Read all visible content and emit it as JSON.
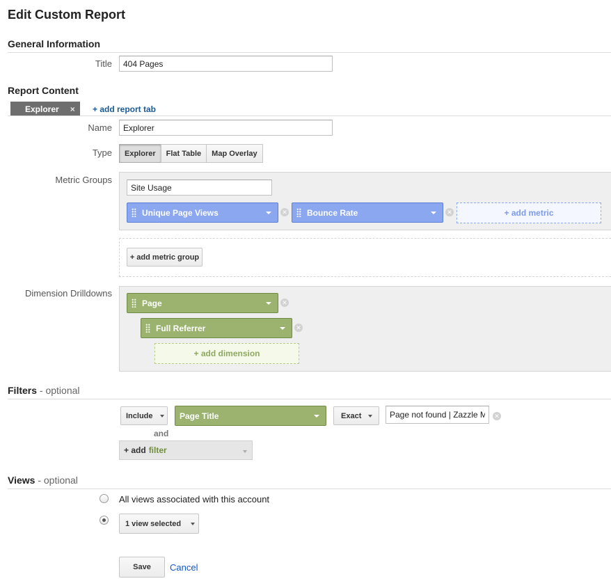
{
  "page_title": "Edit Custom Report",
  "general": {
    "heading": "General Information",
    "title_label": "Title",
    "title_value": "404 Pages"
  },
  "report_content": {
    "heading": "Report Content",
    "active_tab": "Explorer",
    "tab_close": "×",
    "add_tab": "+ add report tab",
    "name_label": "Name",
    "name_value": "Explorer",
    "type_label": "Type",
    "types": [
      "Explorer",
      "Flat Table",
      "Map Overlay"
    ],
    "selected_type": "Explorer",
    "metric_groups_label": "Metric Groups",
    "metric_group_name": "Site Usage",
    "metrics": [
      "Unique Page Views",
      "Bounce Rate"
    ],
    "add_metric": "+ add metric",
    "add_metric_group": "+ add metric group",
    "dimension_label": "Dimension Drilldowns",
    "dimensions": [
      "Page",
      "Full Referrer"
    ],
    "add_dimension": "+ add dimension"
  },
  "filters": {
    "heading": "Filters",
    "optional": " - optional",
    "include": "Include",
    "dimension": "Page Title",
    "match": "Exact",
    "value": "Page not found | Zazzle M",
    "and": "and",
    "add_prefix": "+ add",
    "add_word": "filter"
  },
  "views": {
    "heading": "Views",
    "optional": " - optional",
    "all_views": "All views associated with this account",
    "selected": "1 view selected",
    "selected_option": "1 view selected"
  },
  "actions": {
    "save": "Save",
    "cancel": "Cancel"
  },
  "colors": {
    "metric_blue": "#8ba7ef",
    "dimension_green": "#9bb36f",
    "link_blue": "#1155cc"
  }
}
